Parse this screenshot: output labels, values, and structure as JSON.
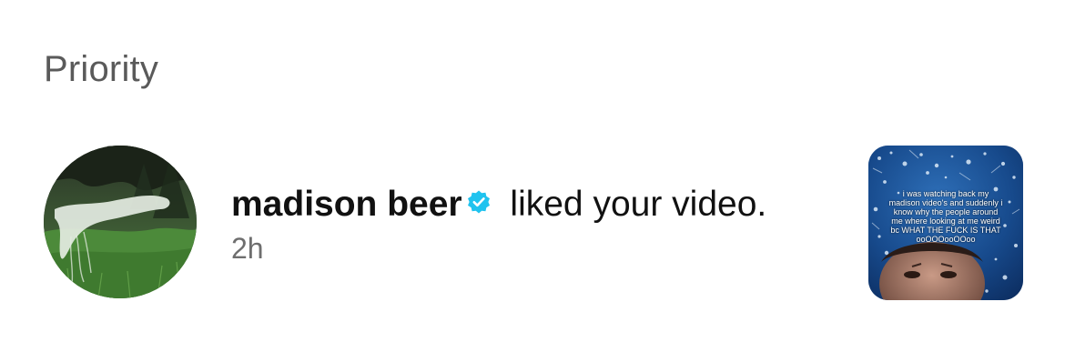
{
  "section": {
    "title": "Priority"
  },
  "notification": {
    "username": "madison beer",
    "verified": true,
    "action": " liked your video.",
    "time": "2h",
    "avatar_icon": "profile-avatar",
    "verified_icon": "verified-badge-icon",
    "thumbnail": {
      "caption": "i was watching back my madison video's and suddenly i know why the people around me where looking at me weird bc WHAT THE FUCK IS THAT ooOOOooOOoo"
    }
  },
  "colors": {
    "title": "#5a5a5a",
    "text": "#111111",
    "time": "#6e6e6e",
    "verified": "#20c3ef"
  }
}
